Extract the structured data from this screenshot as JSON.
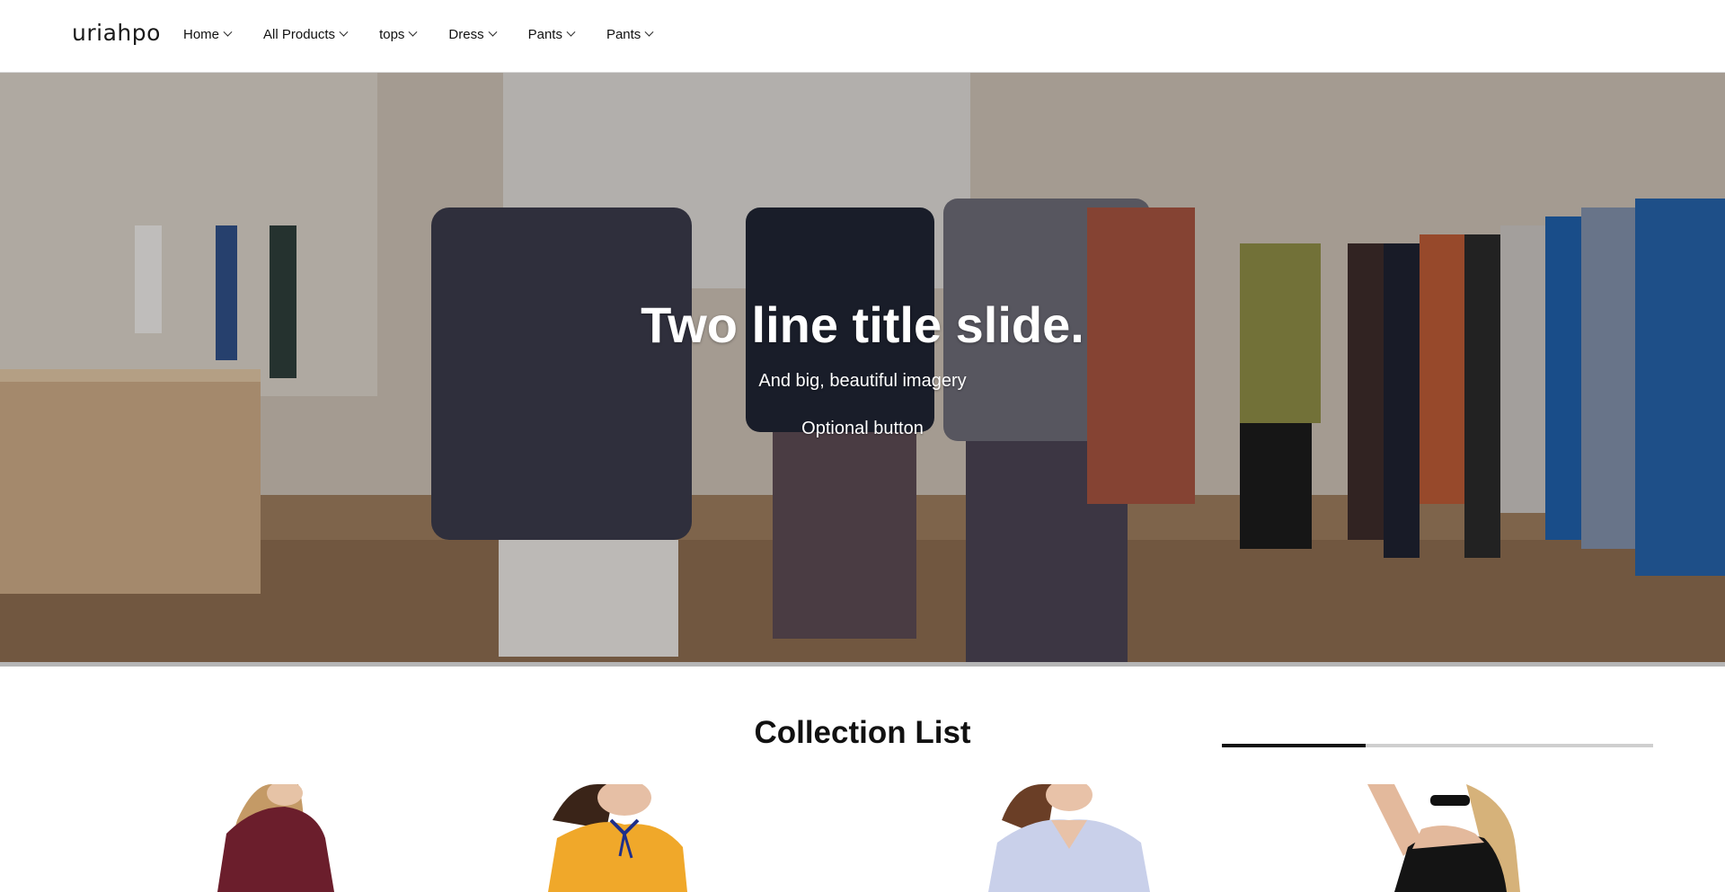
{
  "header": {
    "logo": "uriahpo",
    "nav": [
      {
        "label": "Home"
      },
      {
        "label": "All Products"
      },
      {
        "label": "tops"
      },
      {
        "label": "Dress"
      },
      {
        "label": "Pants"
      },
      {
        "label": "Pants"
      }
    ]
  },
  "hero": {
    "title": "Two line title slide.",
    "subtitle": "And big, beautiful imagery",
    "button_label": "Optional button"
  },
  "collection": {
    "title": "Collection List",
    "scroll_progress": 0.333,
    "cards": [
      {
        "icon": "burgundy-top-image"
      },
      {
        "icon": "yellow-floral-blouse-image"
      },
      {
        "icon": "blue-floral-dress-image"
      },
      {
        "icon": "black-one-shoulder-top-image"
      }
    ]
  },
  "colors": {
    "text": "#111111",
    "header_border": "#d8d8d8",
    "progress_track": "#cfcfcf",
    "progress_fill": "#111111"
  }
}
